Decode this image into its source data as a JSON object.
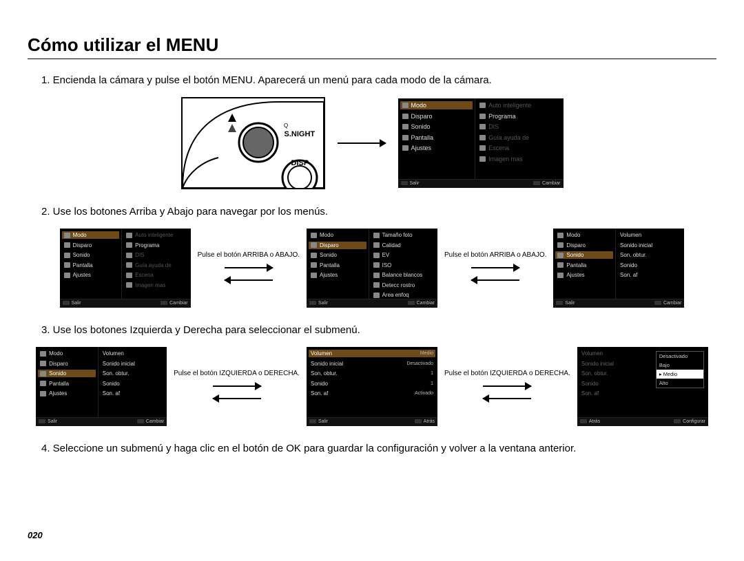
{
  "page_number": "020",
  "title": "Cómo utilizar el MENU",
  "steps": {
    "s1": "1. Encienda la cámara y pulse el botón MENU. Aparecerá un menú para cada modo de la cámara.",
    "s2": "2. Use los botones Arriba y Abajo para navegar por los menús.",
    "s3": "3. Use los botones Izquierda y Derecha para seleccionar el submenú.",
    "s4": "4. Seleccione un submenú y haga clic en el botón de OK para guardar la configuración y volver a la ventana anterior."
  },
  "arrow_labels": {
    "up_down": "Pulse el botón ARRIBA o ABAJO.",
    "left_right": "Pulse el botón IZQUIERDA o DERECHA."
  },
  "camera_labels": {
    "snight": "S.NIGHT",
    "disp": "DISP"
  },
  "menu_left": {
    "modo": "Modo",
    "disparo": "Disparo",
    "sonido": "Sonido",
    "pantalla": "Pantalla",
    "ajustes": "Ajustes"
  },
  "menu_right_modo": {
    "auto_int": "Auto inteligente",
    "programa": "Programa",
    "dis": "DIS",
    "guia": "Guía ayuda de",
    "escena": "Escena",
    "imagen": "Imagen mas"
  },
  "menu_right_disparo": {
    "tamano": "Tamaño foto",
    "calidad": "Calidad",
    "ev": "EV",
    "iso": "ISO",
    "balance": "Balance blancos",
    "detecc": "Detecc rostro",
    "area": "Area enfoq"
  },
  "menu_right_sonido": {
    "volumen": "Volumen",
    "sonido_inicial": "Sonido inicial",
    "son_obtur": "Son. obtur.",
    "sonido": "Sonido",
    "son_af": "Son. af"
  },
  "menu_sonido_values": {
    "volumen_k": "Volumen",
    "volumen_v": "Medio",
    "sonido_inicial_k": "Sonido inicial",
    "sonido_inicial_v": "Desactivado",
    "son_obtur_k": "Son. obtur.",
    "son_obtur_v": "1",
    "sonido_k": "Sonido",
    "sonido_v": "1",
    "son_af_k": "Son. af",
    "son_af_v": "Activado"
  },
  "volume_options": {
    "desactivado": "Desactivado",
    "bajo": "Bajo",
    "medio": "Medio",
    "alto": "Alto"
  },
  "footer": {
    "salir": "Salir",
    "cambiar": "Cambiar",
    "atras": "Atrás",
    "configurar": "Configurar"
  }
}
